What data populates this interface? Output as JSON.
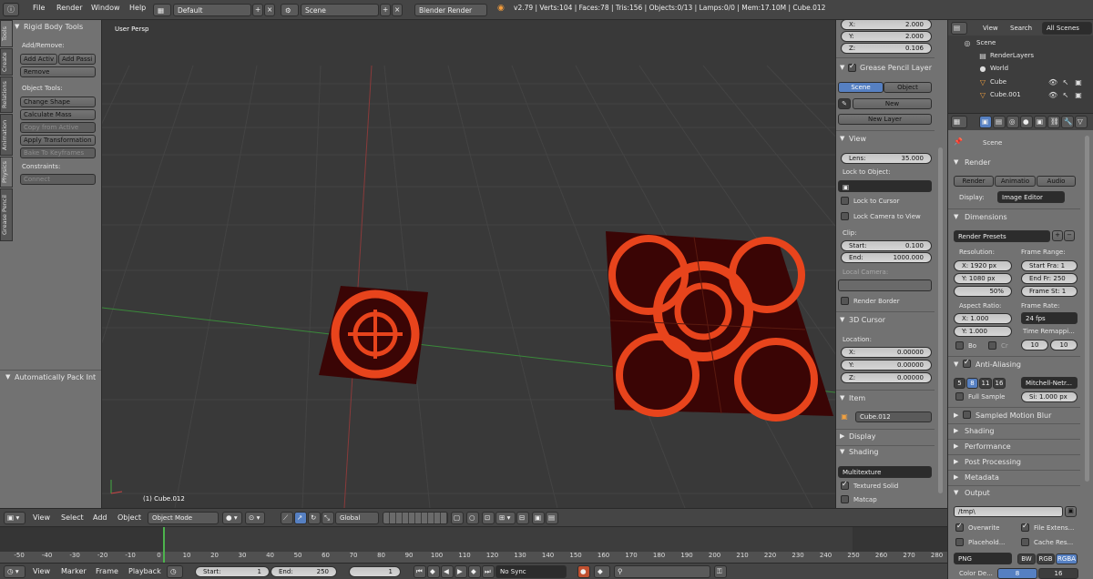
{
  "topbar": {
    "menu": [
      "File",
      "Render",
      "Window",
      "Help"
    ],
    "layout": "Default",
    "scene": "Scene",
    "engine": "Blender Render",
    "stats": "v2.79 | Verts:104 | Faces:78 | Tris:156 | Objects:0/13 | Lamps:0/0 | Mem:17.10M | Cube.012"
  },
  "toolshelf": {
    "tabs": [
      "Tools",
      "Create",
      "Relations",
      "Animation",
      "Physics",
      "Grease Pencil"
    ],
    "title": "Rigid Body Tools",
    "add_remove_label": "Add/Remove:",
    "add_active": "Add Activ",
    "add_passive": "Add Passi",
    "remove": "Remove",
    "object_tools_label": "Object Tools:",
    "change_shape": "Change Shape",
    "calculate_mass": "Calculate Mass",
    "copy_from_active": "Copy from Active",
    "apply_transformation": "Apply Transformation",
    "bake_to_keyframes": "Bake To Keyframes",
    "constraints_label": "Constraints:",
    "connect": "Connect",
    "operator_panel": "Automatically Pack Int"
  },
  "viewport": {
    "view_name": "User Persp",
    "object_label": "(1) Cube.012"
  },
  "n_panel": {
    "dims": [
      {
        "k": "X:",
        "v": "2.000"
      },
      {
        "k": "Y:",
        "v": "2.000"
      },
      {
        "k": "Z:",
        "v": "0.106"
      }
    ],
    "grease_pencil": "Grease Pencil Layer",
    "gp_scene": "Scene",
    "gp_object": "Object",
    "gp_new": "New",
    "gp_new_layer": "New Layer",
    "view_header": "View",
    "lens_k": "Lens:",
    "lens_v": "35.000",
    "lock_to_object": "Lock to Object:",
    "lock_to_cursor": "Lock to Cursor",
    "lock_camera": "Lock Camera to View",
    "clip": "Clip:",
    "clip_start_k": "Start:",
    "clip_start_v": "0.100",
    "clip_end_k": "End:",
    "clip_end_v": "1000.000",
    "local_camera": "Local Camera:",
    "render_border": "Render Border",
    "cursor_header": "3D Cursor",
    "location": "Location:",
    "cursor": [
      {
        "k": "X:",
        "v": "0.00000"
      },
      {
        "k": "Y:",
        "v": "0.00000"
      },
      {
        "k": "Z:",
        "v": "0.00000"
      }
    ],
    "item_header": "Item",
    "item_name": "Cube.012",
    "display_header": "Display",
    "shading_header": "Shading",
    "shading_mode": "Multitexture",
    "textured_solid": "Textured Solid",
    "matcap": "Matcap"
  },
  "outliner": {
    "view": "View",
    "search": "Search",
    "all_scenes": "All Scenes",
    "items": [
      "Scene",
      "RenderLayers",
      "World",
      "Cube",
      "Cube.001"
    ]
  },
  "properties": {
    "scene": "Scene",
    "render_header": "Render",
    "render_btn": "Render",
    "anim_btn": "Animatio",
    "audio_btn": "Audio",
    "display_k": "Display:",
    "display_v": "Image Editor",
    "dimensions_header": "Dimensions",
    "render_presets": "Render Presets",
    "resolution": "Resolution:",
    "res_x": "X:  1920 px",
    "res_y": "Y:  1080 px",
    "res_pct": "50%",
    "frame_range": "Frame Range:",
    "start_fr": "Start Fra:   1",
    "end_fr": "End Fr:  250",
    "frame_step": "Frame St:   1",
    "aspect_ratio": "Aspect Ratio:",
    "asp_x": "X:    1.000",
    "asp_y": "Y:    1.000",
    "frame_rate": "Frame Rate:",
    "fps": "24 fps",
    "time_remap": "Time Remappi...",
    "remap_old": "10",
    "remap_new": "10",
    "bo": "Bo",
    "cr": "Cr",
    "aa_header": "Anti-Aliasing",
    "aa_samples": [
      "5",
      "8",
      "11",
      "16"
    ],
    "aa_filter": "Mitchell-Netr...",
    "full_sample": "Full Sample",
    "filter_size": "Si: 1.000 px",
    "motion_blur": "Sampled Motion Blur",
    "shading": "Shading",
    "performance": "Performance",
    "post_processing": "Post Processing",
    "metadata": "Metadata",
    "output_header": "Output",
    "output_path": "/tmp\\",
    "overwrite": "Overwrite",
    "file_ext": "File Extens...",
    "placeholders": "Placehold...",
    "cache_result": "Cache Res...",
    "format": "PNG",
    "bw": "BW",
    "rgb": "RGB",
    "rgba": "RGBA",
    "color_depth": "Color De...",
    "depth_8": "8",
    "depth_16": "16"
  },
  "viewport_header": {
    "view": "View",
    "select": "Select",
    "add": "Add",
    "object": "Object",
    "mode": "Object Mode",
    "orientation": "Global"
  },
  "timeline": {
    "ticks": [
      "-50",
      "-40",
      "-30",
      "-20",
      "-10",
      "0",
      "10",
      "20",
      "30",
      "40",
      "50",
      "60",
      "70",
      "80",
      "90",
      "100",
      "110",
      "120",
      "130",
      "140",
      "150",
      "160",
      "170",
      "180",
      "190",
      "200",
      "210",
      "220",
      "230",
      "240",
      "250",
      "260",
      "270",
      "280"
    ],
    "view": "View",
    "marker": "Marker",
    "frame": "Frame",
    "playback": "Playback",
    "start": "Start:",
    "start_v": "1",
    "end": "End:",
    "end_v": "250",
    "current": "1",
    "sync": "No Sync"
  }
}
